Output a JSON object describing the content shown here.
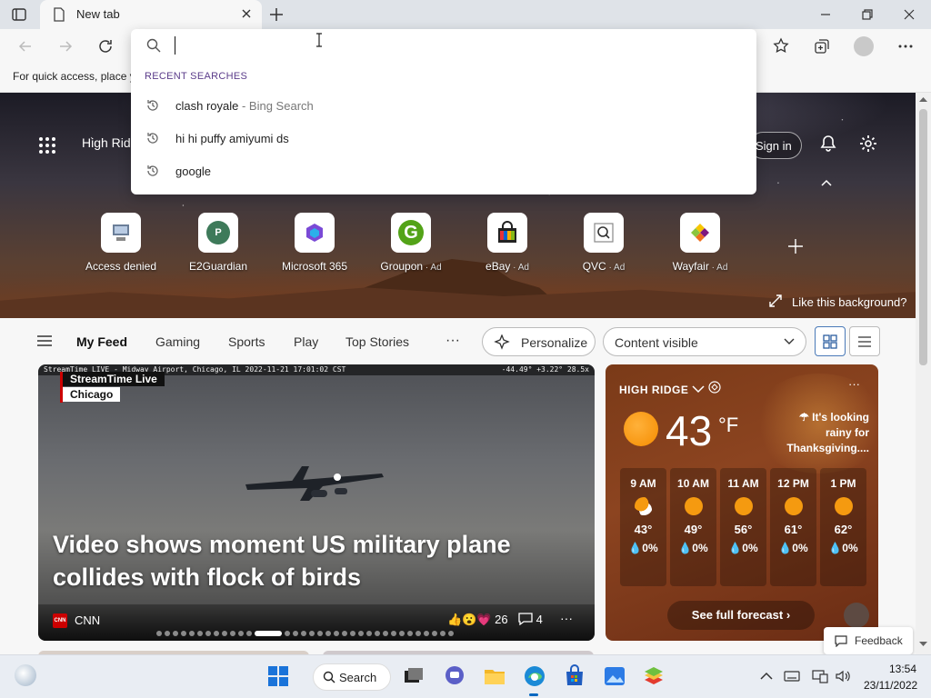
{
  "browser": {
    "tab_title": "New tab",
    "fav_hint": "For quick access, place y"
  },
  "omnibox": {
    "query": "",
    "section_heading": "RECENT SEARCHES",
    "items": [
      {
        "text": "clash royale",
        "suffix": " - Bing Search"
      },
      {
        "text": "hi hi puffy amiyumi ds",
        "suffix": ""
      },
      {
        "text": "google",
        "suffix": ""
      }
    ]
  },
  "hero": {
    "location": "High Rid",
    "sign_in": "Sign in",
    "like_background": "Like this background?",
    "tiles": [
      {
        "label": "Access denied",
        "ad": ""
      },
      {
        "label": "E2Guardian",
        "ad": ""
      },
      {
        "label": "Microsoft 365",
        "ad": ""
      },
      {
        "label": "Groupon",
        "ad": " · Ad"
      },
      {
        "label": "eBay",
        "ad": " · Ad"
      },
      {
        "label": "QVC",
        "ad": " · Ad"
      },
      {
        "label": "Wayfair",
        "ad": " · Ad"
      }
    ]
  },
  "feed_nav": {
    "items": [
      "My Feed",
      "Gaming",
      "Sports",
      "Play",
      "Top Stories"
    ],
    "more": "···",
    "personalize": "Personalize",
    "content_visible": "Content visible"
  },
  "news": {
    "cam_text": "StreamTime LIVE - Midway Airport, Chicago, IL  2022-11-21 17:01:02 CST",
    "cam_right": "-44.49°  +3.22°  28.5x",
    "stream_label": "StreamTime Live",
    "stream_city": "Chicago",
    "headline": "Video shows moment US military plane collides with flock of birds",
    "source_logo": "CNN",
    "source": "CNN",
    "reaction_count": "26",
    "comment_count": "4",
    "more": "···"
  },
  "weather": {
    "location": "HIGH RIDGE",
    "temp": "43",
    "unit": "°F",
    "alert": "It's looking rainy for Thanksgiving....",
    "more": "···",
    "hours": [
      {
        "time": "9 AM",
        "temp": "43°",
        "precip": "0%",
        "icon": "partly-cloudy"
      },
      {
        "time": "10 AM",
        "temp": "49°",
        "precip": "0%",
        "icon": "sunny"
      },
      {
        "time": "11 AM",
        "temp": "56°",
        "precip": "0%",
        "icon": "sunny"
      },
      {
        "time": "12 PM",
        "temp": "61°",
        "precip": "0%",
        "icon": "sunny"
      },
      {
        "time": "1 PM",
        "temp": "62°",
        "precip": "0%",
        "icon": "sunny"
      }
    ],
    "see_forecast": "See full forecast"
  },
  "feedback": "Feedback",
  "taskbar": {
    "search": "Search",
    "time": "13:54",
    "date": "23/11/2022"
  },
  "colors": {
    "accent": "#0067c0",
    "omnibox_heading": "#5b3c8a",
    "weather_bg": "#8c4420"
  }
}
